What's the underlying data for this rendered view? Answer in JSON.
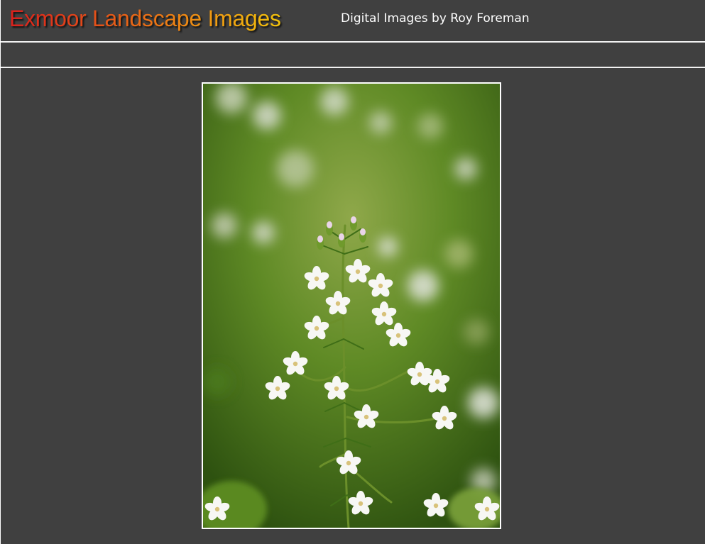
{
  "header": {
    "title": "Exmoor Landscape Images",
    "subtitle": "Digital Images by Roy Foreman"
  },
  "main": {
    "photo": {
      "subject": "white-flower-cluster-photo"
    }
  },
  "colors": {
    "background": "#404040",
    "rule": "#f2f2f2",
    "title_gradient_start": "#d9201c",
    "title_gradient_end": "#f2c20c",
    "subtitle": "#ffffff"
  }
}
